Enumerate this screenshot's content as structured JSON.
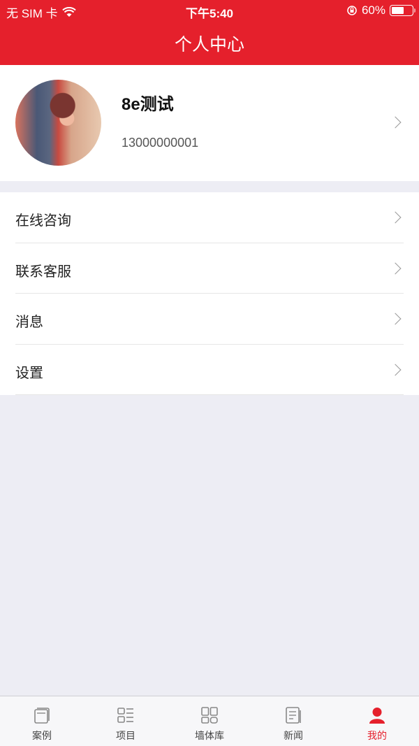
{
  "status_bar": {
    "carrier": "无 SIM 卡",
    "time": "下午5:40",
    "battery_percent": "60%",
    "battery_level": 0.6
  },
  "header": {
    "title": "个人中心"
  },
  "profile": {
    "name": "8e测试",
    "phone": "13000000001"
  },
  "menu": [
    {
      "label": "在线咨询"
    },
    {
      "label": "联系客服"
    },
    {
      "label": "消息"
    },
    {
      "label": "设置"
    }
  ],
  "tabbar": {
    "tabs": [
      {
        "label": "案例",
        "icon": "book-icon"
      },
      {
        "label": "项目",
        "icon": "list-icon"
      },
      {
        "label": "墙体库",
        "icon": "grid-icon"
      },
      {
        "label": "新闻",
        "icon": "news-icon"
      },
      {
        "label": "我的",
        "icon": "user-icon",
        "active": true
      }
    ],
    "active_color": "#e5202c"
  },
  "colors": {
    "brand": "#e5202c",
    "background": "#ededf4"
  }
}
